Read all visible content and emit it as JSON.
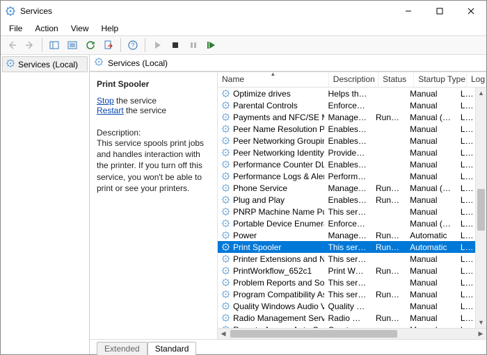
{
  "window": {
    "title": "Services"
  },
  "menu": {
    "file": "File",
    "action": "Action",
    "view": "View",
    "help": "Help"
  },
  "tree": {
    "root": "Services (Local)"
  },
  "content_header": "Services (Local)",
  "detail": {
    "title": "Print Spooler",
    "stop_link": "Stop",
    "stop_suffix": " the service",
    "restart_link": "Restart",
    "restart_suffix": " the service",
    "desc_label": "Description:",
    "desc_text": "This service spools print jobs and handles interaction with the printer. If you turn off this service, you won't be able to print or see your printers."
  },
  "columns": {
    "name": "Name",
    "desc": "Description",
    "status": "Status",
    "startup": "Startup Type",
    "logon": "Log"
  },
  "services": [
    {
      "name": "Optimize drives",
      "desc": "Helps the c...",
      "status": "",
      "startup": "Manual",
      "logon": "Loc"
    },
    {
      "name": "Parental Controls",
      "desc": "Enforces pa...",
      "status": "",
      "startup": "Manual",
      "logon": "Loc"
    },
    {
      "name": "Payments and NFC/SE Man...",
      "desc": "Manages pa...",
      "status": "Running",
      "startup": "Manual (Trig...",
      "logon": "Loc"
    },
    {
      "name": "Peer Name Resolution Prot...",
      "desc": "Enables serv...",
      "status": "",
      "startup": "Manual",
      "logon": "Loc"
    },
    {
      "name": "Peer Networking Grouping",
      "desc": "Enables mul...",
      "status": "",
      "startup": "Manual",
      "logon": "Loc"
    },
    {
      "name": "Peer Networking Identity M...",
      "desc": "Provides ide...",
      "status": "",
      "startup": "Manual",
      "logon": "Loc"
    },
    {
      "name": "Performance Counter DLL ...",
      "desc": "Enables rem...",
      "status": "",
      "startup": "Manual",
      "logon": "Loc"
    },
    {
      "name": "Performance Logs & Alerts",
      "desc": "Performanc...",
      "status": "",
      "startup": "Manual",
      "logon": "Loc"
    },
    {
      "name": "Phone Service",
      "desc": "Manages th...",
      "status": "Running",
      "startup": "Manual (Trig...",
      "logon": "Loc"
    },
    {
      "name": "Plug and Play",
      "desc": "Enables a c...",
      "status": "Running",
      "startup": "Manual",
      "logon": "Loc"
    },
    {
      "name": "PNRP Machine Name Publi...",
      "desc": "This service ...",
      "status": "",
      "startup": "Manual",
      "logon": "Loc"
    },
    {
      "name": "Portable Device Enumerator...",
      "desc": "Enforces gr...",
      "status": "",
      "startup": "Manual (Trig...",
      "logon": "Loc"
    },
    {
      "name": "Power",
      "desc": "Manages p...",
      "status": "Running",
      "startup": "Automatic",
      "logon": "Loc"
    },
    {
      "name": "Print Spooler",
      "desc": "This service ...",
      "status": "Running",
      "startup": "Automatic",
      "logon": "Loc",
      "selected": true
    },
    {
      "name": "Printer Extensions and Notif...",
      "desc": "This service ...",
      "status": "",
      "startup": "Manual",
      "logon": "Loc"
    },
    {
      "name": "PrintWorkflow_652c1",
      "desc": "Print Workfl",
      "status": "Running",
      "startup": "Manual",
      "logon": "Loc"
    },
    {
      "name": "Problem Reports and Soluti...",
      "desc": "This service ...",
      "status": "",
      "startup": "Manual",
      "logon": "Loc"
    },
    {
      "name": "Program Compatibility Assi...",
      "desc": "This service ...",
      "status": "Running",
      "startup": "Manual",
      "logon": "Loc"
    },
    {
      "name": "Quality Windows Audio Vid...",
      "desc": "Quality Win...",
      "status": "",
      "startup": "Manual",
      "logon": "Loc"
    },
    {
      "name": "Radio Management Service",
      "desc": "Radio Mana...",
      "status": "Running",
      "startup": "Manual",
      "logon": "Loc"
    },
    {
      "name": "Remote Access Auto Conne...",
      "desc": "Creates a co...",
      "status": "",
      "startup": "Manual",
      "logon": "Loc"
    }
  ],
  "tabs": {
    "extended": "Extended",
    "standard": "Standard"
  }
}
